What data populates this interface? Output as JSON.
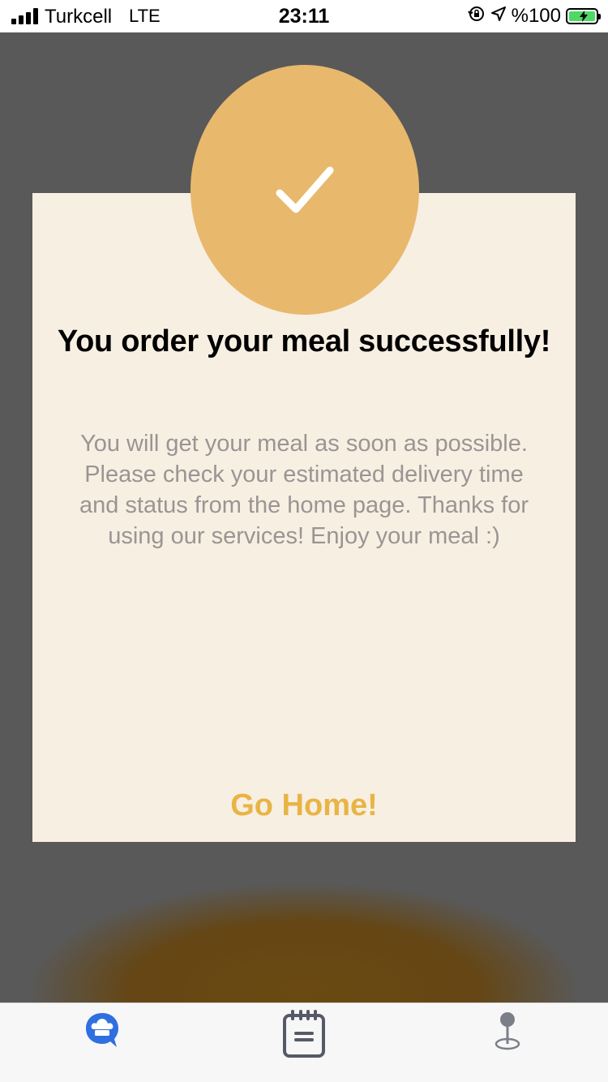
{
  "status_bar": {
    "carrier": "Turkcell",
    "network": "LTE",
    "time": "23:11",
    "battery_percent": "%100",
    "icons": [
      "signal-bars-icon",
      "orientation-lock-icon",
      "location-arrow-icon",
      "battery-charging-icon"
    ],
    "battery_level": 1.0
  },
  "modal": {
    "icon": "checkmark-icon",
    "title": "You order your meal successfully!",
    "message": "You will get your meal as soon as possible. Please check your estimated delivery time and status from the home page. Thanks for using our services! Enjoy your meal :)",
    "button_label": "Go Home!"
  },
  "tab_bar": {
    "tabs": [
      {
        "icon": "chef-chat-icon",
        "active": true
      },
      {
        "icon": "notepad-icon",
        "active": false
      },
      {
        "icon": "map-pin-icon",
        "active": false
      }
    ]
  },
  "colors": {
    "accent": "#e8b86d",
    "button_text": "#e8b445",
    "card_background": "#f8efe3",
    "overlay": "#595959",
    "active_tab": "#2f6fe0",
    "inactive_tab": "#555a66",
    "battery_fill": "#4cd964"
  }
}
